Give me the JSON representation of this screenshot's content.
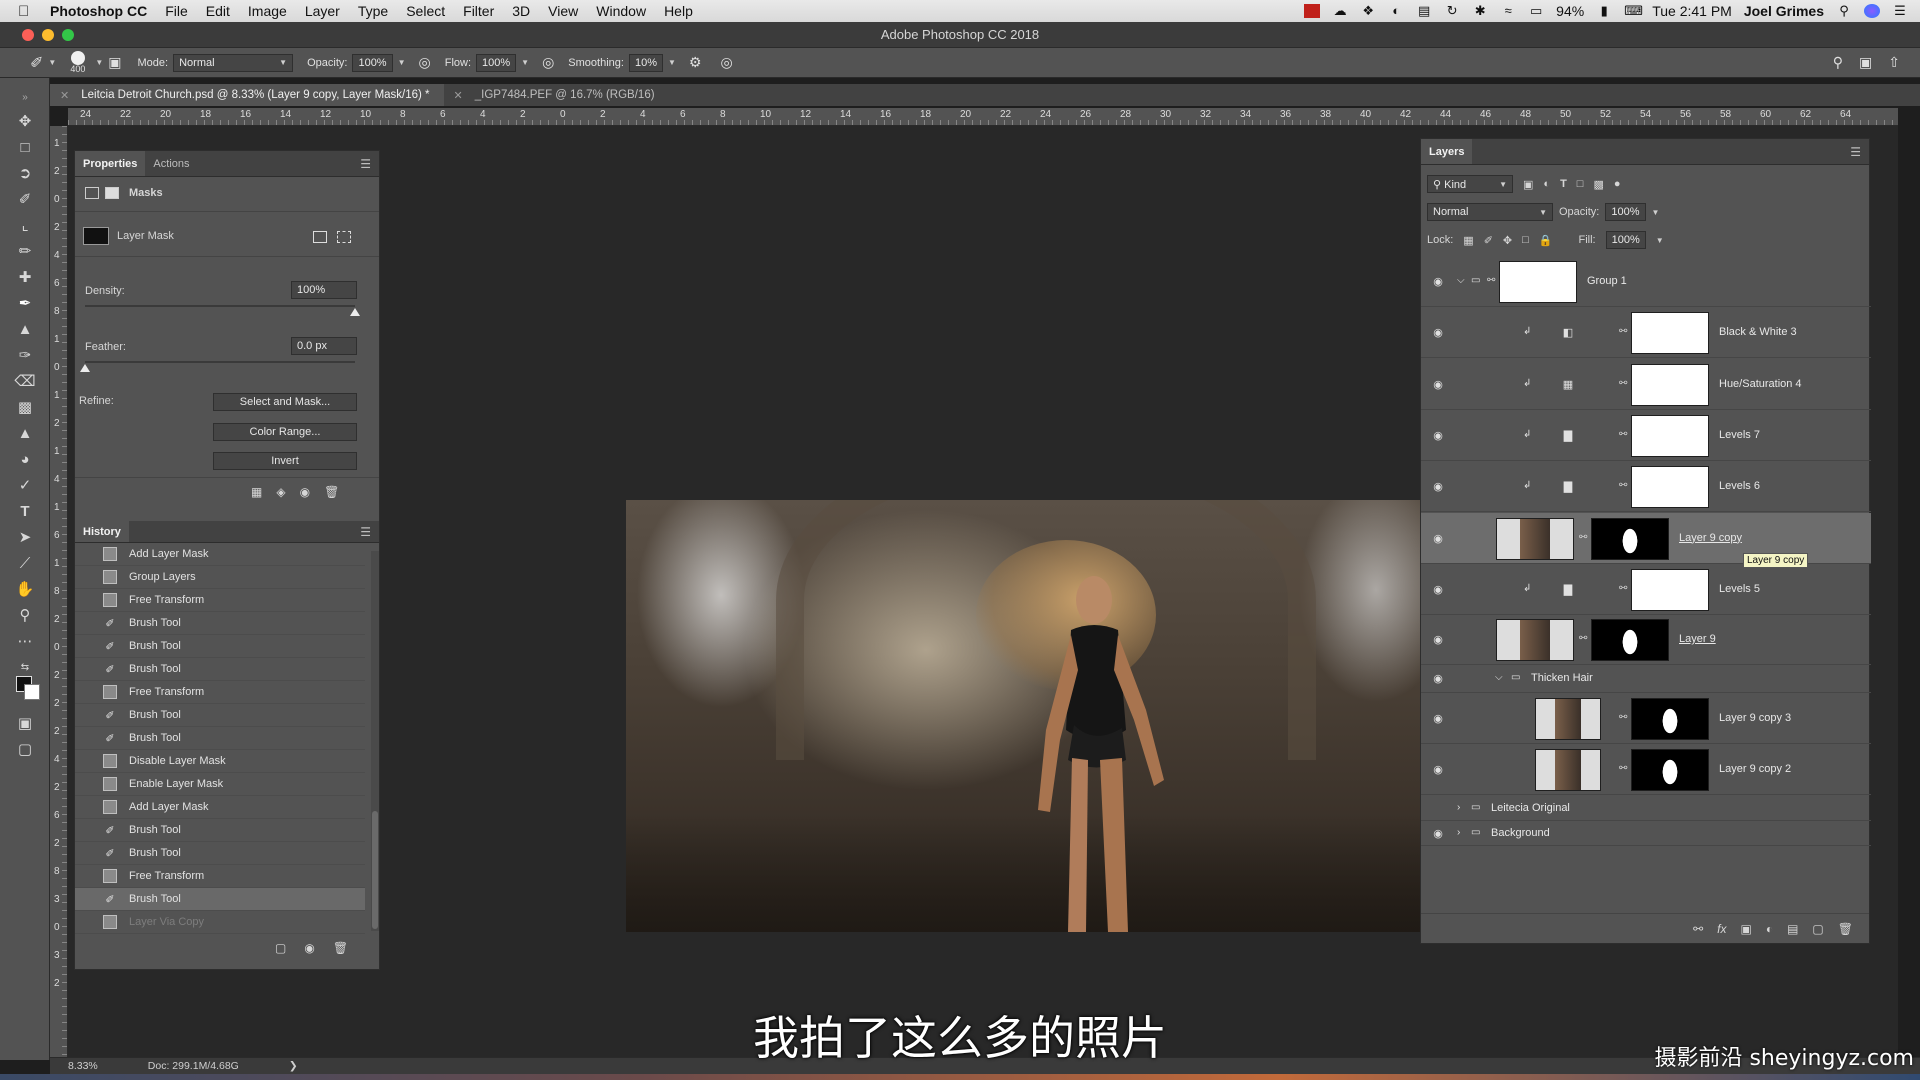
{
  "menubar": {
    "app_name": "Photoshop CC",
    "menus": [
      "File",
      "Edit",
      "Image",
      "Layer",
      "Type",
      "Select",
      "Filter",
      "3D",
      "View",
      "Window",
      "Help"
    ],
    "battery": "94%",
    "clock": "Tue 2:41 PM",
    "user": "Joel Grimes"
  },
  "window": {
    "title": "Adobe Photoshop CC 2018"
  },
  "options": {
    "brush_size": "400",
    "mode_label": "Mode:",
    "mode_value": "Normal",
    "opacity_label": "Opacity:",
    "opacity_value": "100%",
    "flow_label": "Flow:",
    "flow_value": "100%",
    "smoothing_label": "Smoothing:",
    "smoothing_value": "10%"
  },
  "tabs": [
    {
      "label": "Leitcia Detroit Church.psd @ 8.33% (Layer 9 copy, Layer Mask/16) *"
    },
    {
      "label": "_IGP7484.PEF @ 16.7% (RGB/16)"
    }
  ],
  "hruler_labels": [
    "24",
    "22",
    "20",
    "18",
    "16",
    "14",
    "12",
    "10",
    "8",
    "6",
    "4",
    "2",
    "0",
    "2",
    "4",
    "6",
    "8",
    "10",
    "12",
    "14",
    "16",
    "18",
    "20",
    "22",
    "24",
    "26",
    "28",
    "30",
    "32",
    "34",
    "36",
    "38",
    "40",
    "42",
    "44",
    "46",
    "48",
    "50",
    "52",
    "54",
    "56",
    "58",
    "60",
    "62",
    "64"
  ],
  "vruler_labels": [
    "1",
    "2",
    "0",
    "2",
    "4",
    "6",
    "8",
    "1",
    "0",
    "1",
    "2",
    "1",
    "4",
    "1",
    "6",
    "1",
    "8",
    "2",
    "0",
    "2",
    "2",
    "2",
    "4",
    "2",
    "6",
    "2",
    "8",
    "3",
    "0",
    "3",
    "2"
  ],
  "properties": {
    "tab_properties": "Properties",
    "tab_actions": "Actions",
    "masks_label": "Masks",
    "layer_mask_label": "Layer Mask",
    "density_label": "Density:",
    "density_value": "100%",
    "density_level": 1.0,
    "feather_label": "Feather:",
    "feather_value": "0.0 px",
    "feather_level": 0.0,
    "refine_label": "Refine:",
    "select_mask_button": "Select and Mask...",
    "color_range_button": "Color Range...",
    "invert_button": "Invert"
  },
  "history": {
    "title": "History",
    "items": [
      {
        "label": "Add Layer Mask",
        "icon": "doc"
      },
      {
        "label": "Group Layers",
        "icon": "doc"
      },
      {
        "label": "Free Transform",
        "icon": "doc"
      },
      {
        "label": "Brush Tool",
        "icon": "brush"
      },
      {
        "label": "Brush Tool",
        "icon": "brush"
      },
      {
        "label": "Brush Tool",
        "icon": "brush"
      },
      {
        "label": "Free Transform",
        "icon": "doc"
      },
      {
        "label": "Brush Tool",
        "icon": "brush"
      },
      {
        "label": "Brush Tool",
        "icon": "brush"
      },
      {
        "label": "Disable Layer Mask",
        "icon": "doc"
      },
      {
        "label": "Enable Layer Mask",
        "icon": "doc"
      },
      {
        "label": "Add Layer Mask",
        "icon": "doc"
      },
      {
        "label": "Brush Tool",
        "icon": "brush"
      },
      {
        "label": "Brush Tool",
        "icon": "brush"
      },
      {
        "label": "Free Transform",
        "icon": "doc"
      },
      {
        "label": "Brush Tool",
        "icon": "brush",
        "active": true
      },
      {
        "label": "Layer Via Copy",
        "icon": "doc",
        "dim": true
      }
    ]
  },
  "layers_panel": {
    "title": "Layers",
    "filter_kind": "Kind",
    "blend_mode": "Normal",
    "opacity_label": "Opacity:",
    "opacity_value": "100%",
    "lock_label": "Lock:",
    "fill_label": "Fill:",
    "fill_value": "100%",
    "tooltip": "Layer 9 copy",
    "layers": [
      {
        "name": "Group 1",
        "type": "group-thumb"
      },
      {
        "name": "Black & White 3",
        "type": "adjustment",
        "icon": "bw-icon"
      },
      {
        "name": "Hue/Saturation 4",
        "type": "adjustment",
        "icon": "huesat-icon"
      },
      {
        "name": "Levels 7",
        "type": "adjustment",
        "icon": "levels-icon"
      },
      {
        "name": "Levels 6",
        "type": "adjustment",
        "icon": "levels-icon"
      },
      {
        "name": "Layer 9 copy",
        "type": "pixel-mask",
        "selected": true
      },
      {
        "name": "Levels 5",
        "type": "adjustment",
        "icon": "levels-icon"
      },
      {
        "name": "Layer 9",
        "type": "pixel-mask"
      },
      {
        "name": "Thicken Hair",
        "type": "folder"
      },
      {
        "name": "Layer 9 copy 3",
        "type": "pixel-mask-nested"
      },
      {
        "name": "Layer 9 copy 2",
        "type": "pixel-mask-nested"
      },
      {
        "name": "Leitecia Original",
        "type": "folder-collapsed",
        "hidden": true
      },
      {
        "name": "Background",
        "type": "folder-collapsed"
      }
    ]
  },
  "status": {
    "zoom": "8.33%",
    "doc": "Doc: 299.1M/4.68G"
  },
  "subtitle": "我拍了这么多的照片",
  "watermark": "摄影前沿 sheyingyz.com"
}
